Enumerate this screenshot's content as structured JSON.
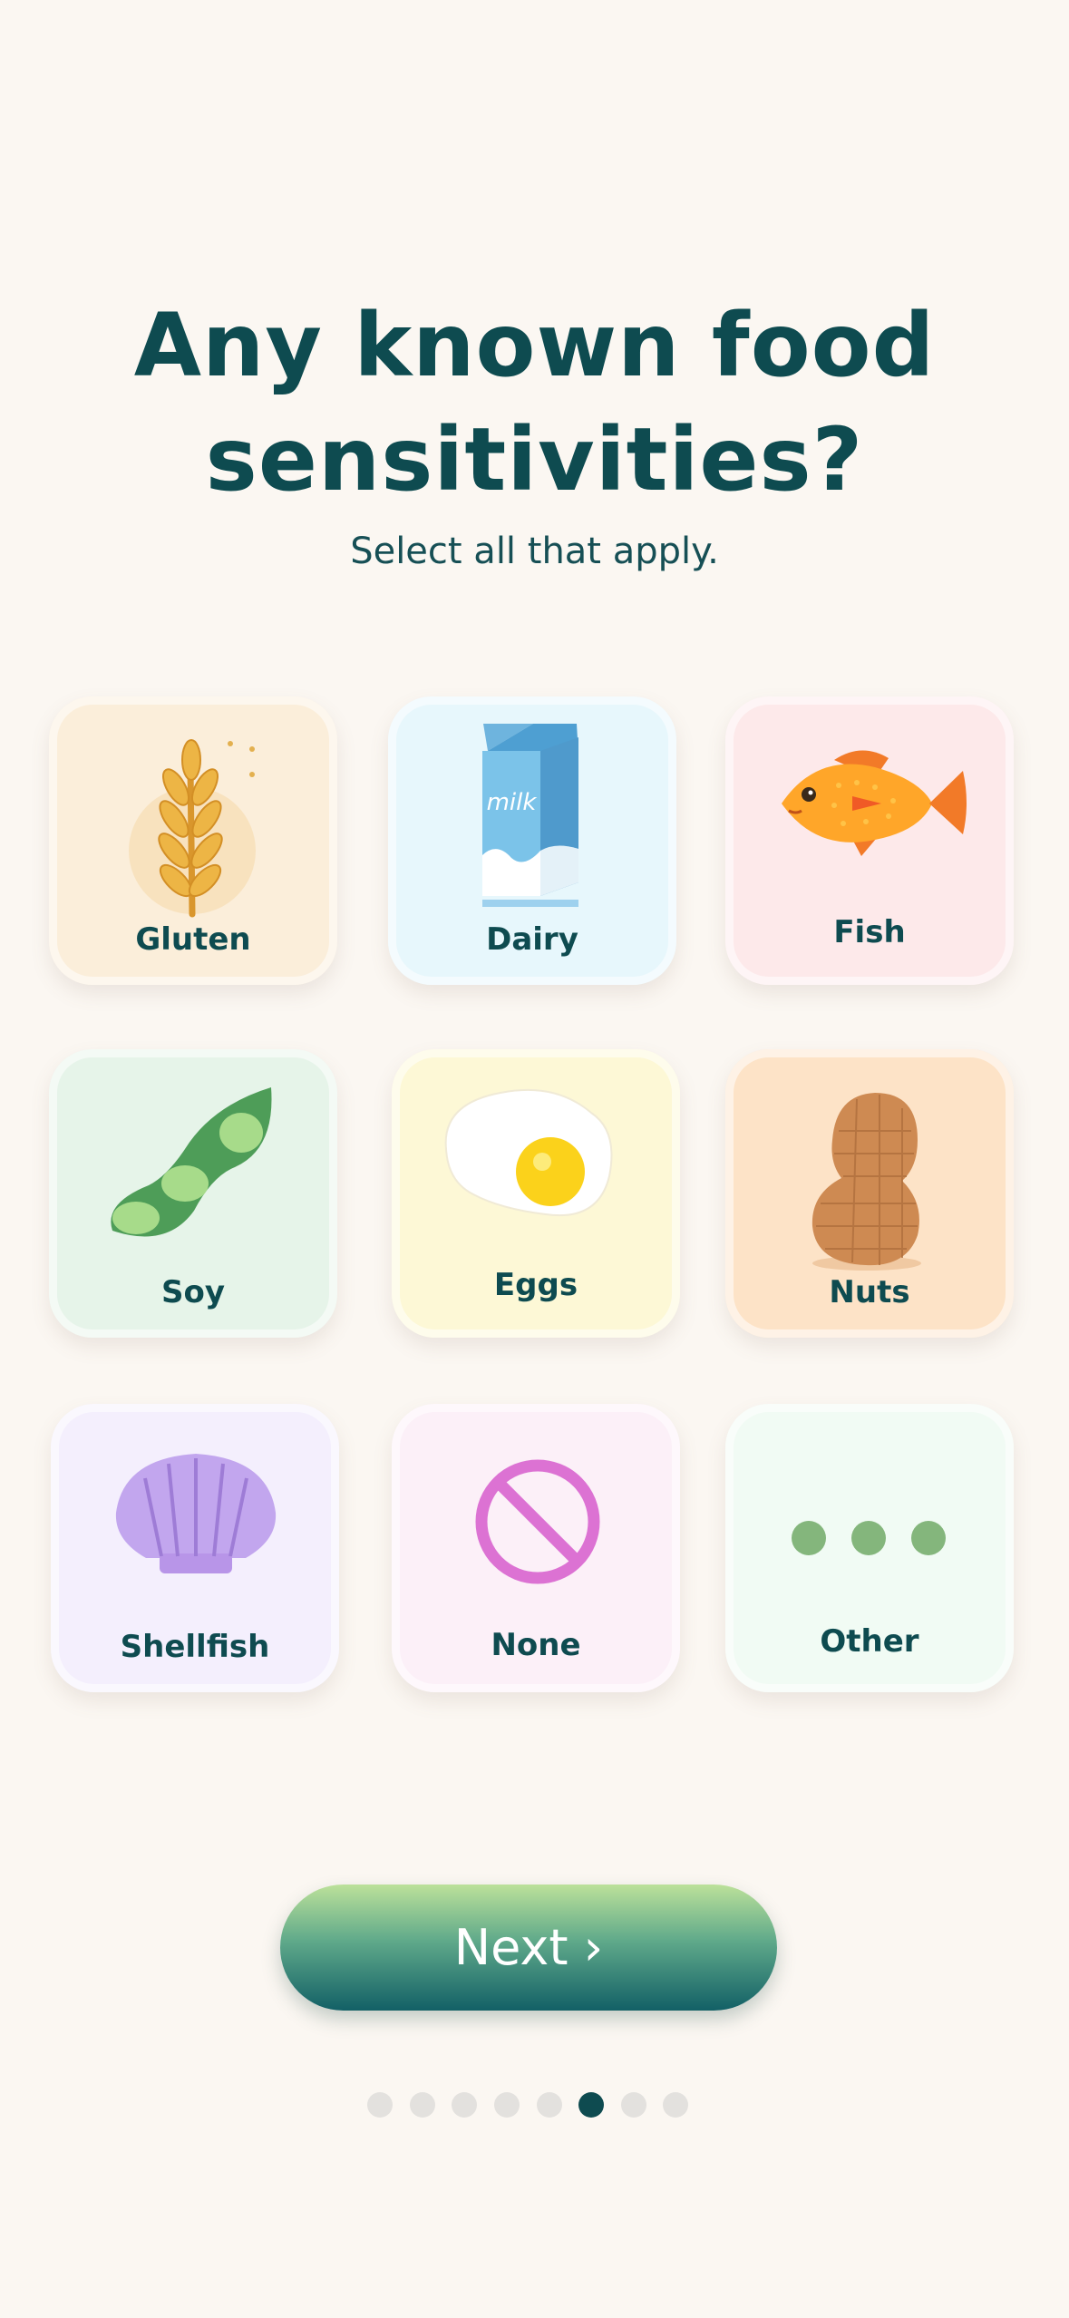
{
  "header": {
    "title_line1": "Any known food",
    "title_line2": "sensitivities?",
    "subtitle": "Select all that apply."
  },
  "options": [
    {
      "label": "Gluten",
      "icon": "wheat-icon",
      "bg": "#FBEEDA"
    },
    {
      "label": "Dairy",
      "icon": "milk-carton-icon",
      "bg": "#E7F7FC"
    },
    {
      "label": "Fish",
      "icon": "fish-icon",
      "bg": "#FDE9EA"
    },
    {
      "label": "Soy",
      "icon": "soybean-pod-icon",
      "bg": "#E6F4E9"
    },
    {
      "label": "Eggs",
      "icon": "fried-egg-icon",
      "bg": "#FDF8D6"
    },
    {
      "label": "Nuts",
      "icon": "peanut-icon",
      "bg": "#FDE3C7"
    },
    {
      "label": "Shellfish",
      "icon": "shell-icon",
      "bg": "#F4EFFD"
    },
    {
      "label": "None",
      "icon": "prohibited-icon",
      "bg": "#FCF0F8"
    },
    {
      "label": "Other",
      "icon": "more-dots-icon",
      "bg": "#F1FBF4"
    }
  ],
  "milk_text": "milk",
  "next_button": {
    "label": "Next ›"
  },
  "pagination": {
    "total": 8,
    "current": 6
  }
}
